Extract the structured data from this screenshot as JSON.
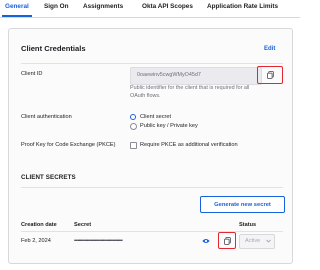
{
  "tabs": [
    {
      "label": "General",
      "active": true
    },
    {
      "label": "Sign On",
      "active": false
    },
    {
      "label": "Assignments",
      "active": false
    },
    {
      "label": "Okta API Scopes",
      "active": false
    },
    {
      "label": "Application Rate Limits",
      "active": false
    }
  ],
  "credentials": {
    "title": "Client Credentials",
    "edit_label": "Edit",
    "client_id_label": "Client ID",
    "client_id_value": "0oaewinv5cwgWMyO45d7",
    "client_id_hint": "Public identifier for the client that is required for all OAuth flows.",
    "auth_label": "Client authentication",
    "auth_options": [
      "Client secret",
      "Public key / Private key"
    ],
    "pkce_label": "Proof Key for Code Exchange (PKCE)",
    "pkce_option": "Require PKCE as additional verification"
  },
  "secrets": {
    "title": "CLIENT SECRETS",
    "generate_label": "Generate new secret",
    "columns": [
      "Creation date",
      "Secret",
      "Status"
    ],
    "rows": [
      {
        "date": "Feb 2, 2024",
        "secret": "••••••••••••••••••••••••••••••••••••••••••",
        "status": "Active"
      }
    ]
  },
  "colors": {
    "accent": "#1662dd",
    "highlight": "#e3262f"
  },
  "icons": [
    "copy-icon",
    "eye-icon",
    "copy-icon",
    "chevron-down-icon"
  ]
}
